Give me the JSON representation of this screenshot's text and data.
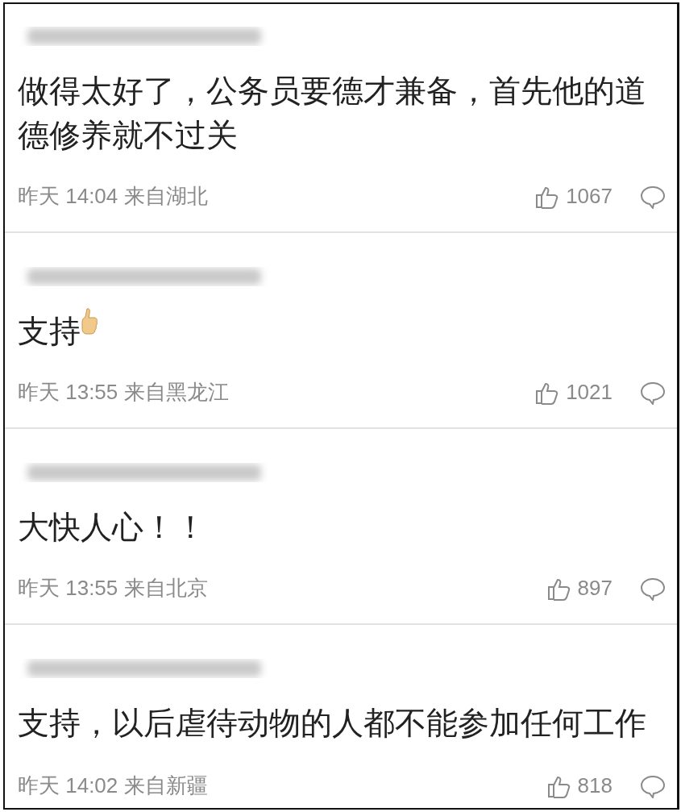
{
  "comments": [
    {
      "text": "做得太好了，公务员要德才兼备，首先他的道德修养就不过关",
      "time": "昨天 14:04 来自湖北",
      "likes": "1067"
    },
    {
      "text": "支持",
      "thumbs_up_emoji": true,
      "time": "昨天 13:55 来自黑龙江",
      "likes": "1021"
    },
    {
      "text": "大快人心！！",
      "time": "昨天 13:55 来自北京",
      "likes": "897"
    },
    {
      "text": "支持，以后虐待动物的人都不能参加任何工作",
      "time": "昨天 14:02 来自新疆",
      "likes": "818"
    }
  ]
}
